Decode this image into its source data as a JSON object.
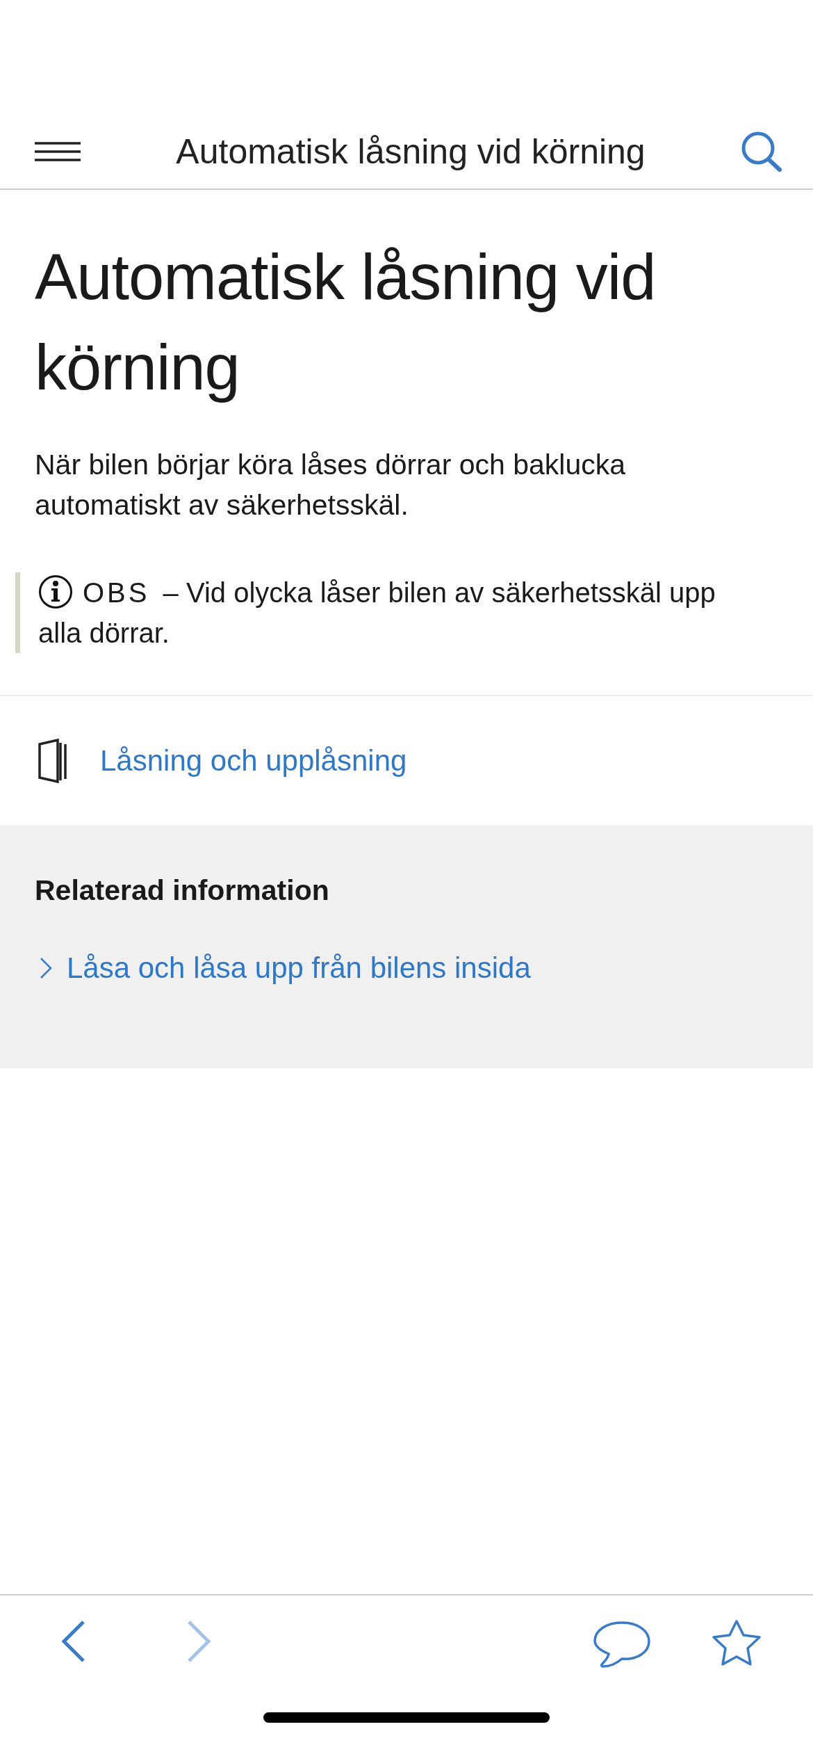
{
  "header": {
    "title": "Automatisk låsning vid körning"
  },
  "article": {
    "title": "Automatisk låsning vid körning",
    "body": "När bilen börjar köra låses dörrar och baklucka automatiskt av säkerhetsskäl.",
    "note": {
      "label": "OBS",
      "dash": "–",
      "text": "Vid olycka låser bilen av säkerhetsskäl upp alla dörrar."
    }
  },
  "topic_link": {
    "label": "Låsning och upplåsning"
  },
  "related": {
    "heading": "Relaterad information",
    "links": [
      {
        "label": "Låsa och låsa upp från bilens insida"
      }
    ]
  },
  "toolbar": {
    "back": {
      "disabled": false
    },
    "forward": {
      "disabled": true
    }
  }
}
